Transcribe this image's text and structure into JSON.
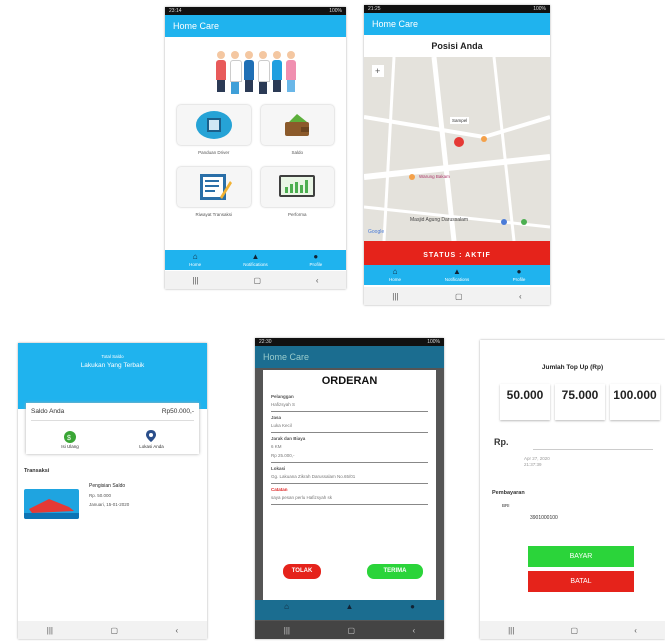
{
  "phone1": {
    "status_time": "23:14",
    "status_right": "100%",
    "app_title": "Home Care",
    "tiles": [
      "Panduan Driver",
      "Saldo",
      "Riwayat Transaksi",
      "Performa"
    ],
    "nav": [
      "Home",
      "Notifications",
      "Profile"
    ]
  },
  "phone2": {
    "status_time": "21:25",
    "status_right": "100%",
    "app_title": "Home Care",
    "page_title": "Posisi Anda",
    "map_labels": {
      "pin": "Sampel",
      "place1": "Warung Bakam",
      "place2": "Masjid Agung Darussalam",
      "google": "Google"
    },
    "status_label": "STATUS : AKTIF",
    "nav": [
      "Home",
      "Notifications",
      "Profile"
    ]
  },
  "phone3": {
    "banner_small": "Total Saldo",
    "banner_title": "Lakukan Yang Terbaik",
    "saldo_label": "Saldo Anda",
    "saldo_value": "Rp50.000,-",
    "action_topup": "Isi Ulang",
    "action_location": "Lokasi Anda",
    "transaksi": "Transaksi",
    "item_title": "Pengisian Saldo",
    "item_amount": "Rp. 50.000",
    "item_date": "Januari, 15-01-2020"
  },
  "phone4": {
    "status_time": "22:30",
    "status_right": "100%",
    "app_title": "Home Care",
    "title": "ORDERAN",
    "fields": [
      {
        "k": "Pelanggan",
        "v": "Hafizsyah S"
      },
      {
        "k": "Jasa",
        "v": "Luka Kecil"
      },
      {
        "k": "Jarak dan Biaya",
        "v": "6 KM"
      },
      {
        "k": "",
        "v": "Rp 25.000,-"
      },
      {
        "k": "Lokasi",
        "v": "Gg. Lakuana Zikrah Darussalam No.65/01"
      },
      {
        "k": "Catatan",
        "v": "saya pesan perlu Hafizsyah sk"
      }
    ],
    "btn_tolak": "TOLAK",
    "btn_terima": "TERIMA"
  },
  "phone5": {
    "topup_title": "Jumlah Top Up (Rp)",
    "amounts": [
      "50.000",
      "75.000",
      "100.000"
    ],
    "rp_label": "Rp.",
    "date_line1": "Apr 27, 2020",
    "date_line2": "21:37:39",
    "pay_head": "Pembayaran",
    "bank": "BRI",
    "account": "3901000100",
    "btn_bayar": "BAYAR",
    "btn_batal": "BATAL"
  }
}
